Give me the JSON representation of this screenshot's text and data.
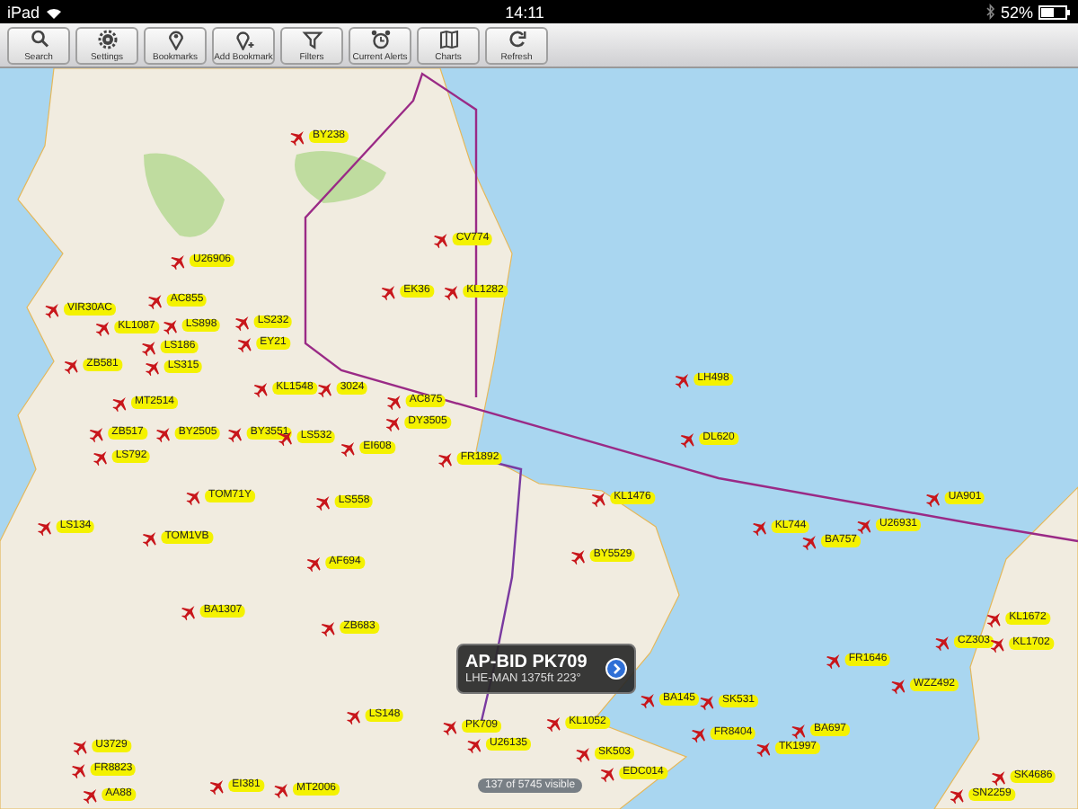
{
  "status_bar": {
    "device": "iPad",
    "time": "14:11",
    "battery": "52%"
  },
  "toolbar": [
    {
      "label": "Search"
    },
    {
      "label": "Settings"
    },
    {
      "label": "Bookmarks"
    },
    {
      "label": "Add Bookmark"
    },
    {
      "label": "Filters"
    },
    {
      "label": "Current Alerts"
    },
    {
      "label": "Charts"
    },
    {
      "label": "Refresh"
    }
  ],
  "flights": [
    {
      "label": "BY238"
    },
    {
      "label": "CV774"
    },
    {
      "label": "U26906"
    },
    {
      "label": "EK36"
    },
    {
      "label": "KL1282"
    },
    {
      "label": "VIR30AC"
    },
    {
      "label": "KL1087"
    },
    {
      "label": "AC855"
    },
    {
      "label": "LS898"
    },
    {
      "label": "LS186"
    },
    {
      "label": "LS232"
    },
    {
      "label": "EY21"
    },
    {
      "label": "ZB581"
    },
    {
      "label": "LS315"
    },
    {
      "label": "KL1548"
    },
    {
      "label": "3024"
    },
    {
      "label": "MT2514"
    },
    {
      "label": "ZB517"
    },
    {
      "label": "BY2505"
    },
    {
      "label": "BY3551"
    },
    {
      "label": "LS532"
    },
    {
      "label": "EI608"
    },
    {
      "label": "AC875"
    },
    {
      "label": "DY3505"
    },
    {
      "label": "FR1892"
    },
    {
      "label": "LS792"
    },
    {
      "label": "LH498"
    },
    {
      "label": "DL620"
    },
    {
      "label": "KL1476"
    },
    {
      "label": "KL744"
    },
    {
      "label": "BA757"
    },
    {
      "label": "U26931"
    },
    {
      "label": "UA901"
    },
    {
      "label": "BY5529"
    },
    {
      "label": "TOM71Y"
    },
    {
      "label": "LS558"
    },
    {
      "label": "LS134"
    },
    {
      "label": "TOM1VB"
    },
    {
      "label": "AF694"
    },
    {
      "label": "BA1307"
    },
    {
      "label": "ZB683"
    },
    {
      "label": "LS148"
    },
    {
      "label": "PK709"
    },
    {
      "label": "U3729"
    },
    {
      "label": "FR8823"
    },
    {
      "label": "AA88"
    },
    {
      "label": "EI381"
    },
    {
      "label": "MT2006"
    },
    {
      "label": "BA145"
    },
    {
      "label": "SK531"
    },
    {
      "label": "KL1052"
    },
    {
      "label": "FR8404"
    },
    {
      "label": "U26135"
    },
    {
      "label": "BA697"
    },
    {
      "label": "TK1997"
    },
    {
      "label": "SK503"
    },
    {
      "label": "EDC014"
    },
    {
      "label": "WZZ492"
    },
    {
      "label": "FR1646"
    },
    {
      "label": "CZ303"
    },
    {
      "label": "KL1672"
    },
    {
      "label": "KL1702"
    },
    {
      "label": "SK4686"
    },
    {
      "label": "SN2259"
    }
  ],
  "callout": {
    "title": "AP-BID PK709",
    "subtitle": "LHE-MAN 1375ft 223°"
  },
  "counter": "137 of 5745 visible"
}
